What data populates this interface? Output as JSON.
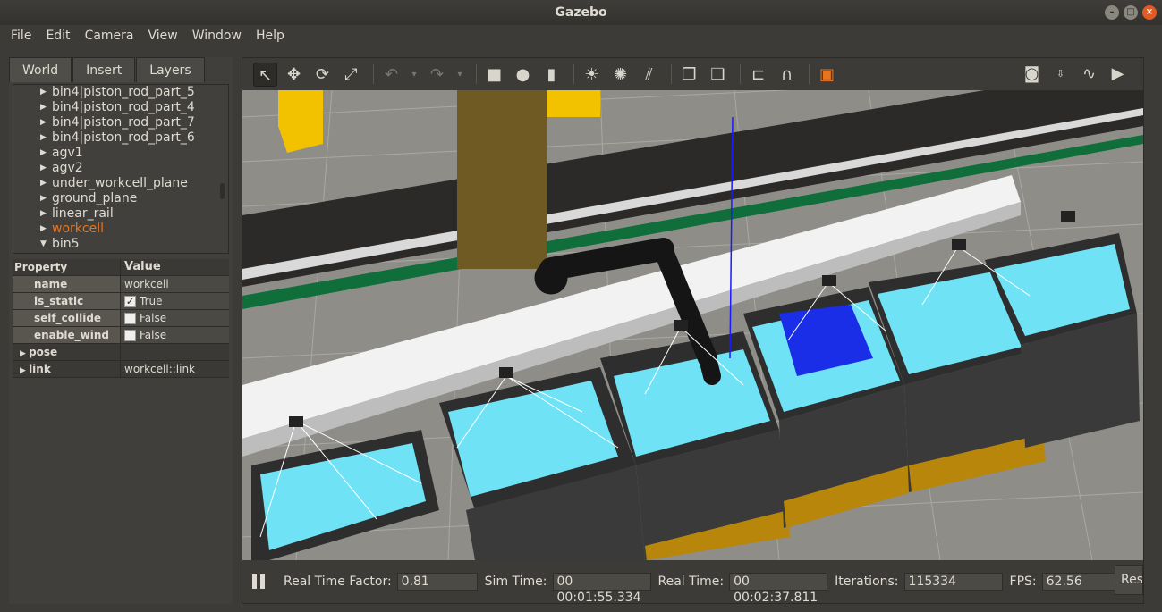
{
  "window": {
    "title": "Gazebo"
  },
  "menu": [
    "File",
    "Edit",
    "Camera",
    "View",
    "Window",
    "Help"
  ],
  "tabs": [
    "World",
    "Insert",
    "Layers"
  ],
  "tree": [
    {
      "label": "bin4|piston_rod_part_5",
      "arrow": "▶",
      "selected": false
    },
    {
      "label": "bin4|piston_rod_part_4",
      "arrow": "▶",
      "selected": false
    },
    {
      "label": "bin4|piston_rod_part_7",
      "arrow": "▶",
      "selected": false
    },
    {
      "label": "bin4|piston_rod_part_6",
      "arrow": "▶",
      "selected": false
    },
    {
      "label": "agv1",
      "arrow": "▶",
      "selected": false
    },
    {
      "label": "agv2",
      "arrow": "▶",
      "selected": false
    },
    {
      "label": "under_workcell_plane",
      "arrow": "▶",
      "selected": false
    },
    {
      "label": "ground_plane",
      "arrow": "▶",
      "selected": false
    },
    {
      "label": "linear_rail",
      "arrow": "▶",
      "selected": false
    },
    {
      "label": "workcell",
      "arrow": "▶",
      "selected": true
    },
    {
      "label": "bin5",
      "arrow": "▼",
      "selected": false
    }
  ],
  "properties": {
    "header_property": "Property",
    "header_value": "Value",
    "rows": [
      {
        "key": "name",
        "value": "workcell",
        "checkbox": null
      },
      {
        "key": "is_static",
        "value": "True",
        "checkbox": true
      },
      {
        "key": "self_collide",
        "value": "False",
        "checkbox": false
      },
      {
        "key": "enable_wind",
        "value": "False",
        "checkbox": false
      }
    ],
    "groups": [
      {
        "key": "pose",
        "value": ""
      },
      {
        "key": "link",
        "value": "workcell::link"
      }
    ]
  },
  "toolbar_icons": [
    "select-icon",
    "translate-icon",
    "rotate-icon",
    "scale-icon",
    "undo-icon",
    "undo-dropdown-icon",
    "redo-icon",
    "redo-dropdown-icon",
    "box-icon",
    "sphere-icon",
    "cylinder-icon",
    "point-light-icon",
    "spot-light-icon",
    "directional-light-icon",
    "copy-icon",
    "paste-icon",
    "align-icon",
    "snap-icon",
    "view-angle-icon"
  ],
  "toolbar_right_icons": [
    "screenshot-icon",
    "log-icon",
    "plot-icon",
    "video-record-icon"
  ],
  "status": {
    "real_time_factor_label": "Real Time Factor:",
    "real_time_factor": "0.81",
    "sim_time_label": "Sim Time:",
    "sim_time": "00 00:01:55.334",
    "real_time_label": "Real Time:",
    "real_time": "00 00:02:37.811",
    "iterations_label": "Iterations:",
    "iterations": "115334",
    "fps_label": "FPS:",
    "fps": "62.56",
    "reset_label": "Reset"
  },
  "colors": {
    "accent": "#e8741f",
    "panel": "#3c3b37",
    "bin_cyan": "#6fe3f5",
    "floor_yellow": "#f2c200"
  }
}
